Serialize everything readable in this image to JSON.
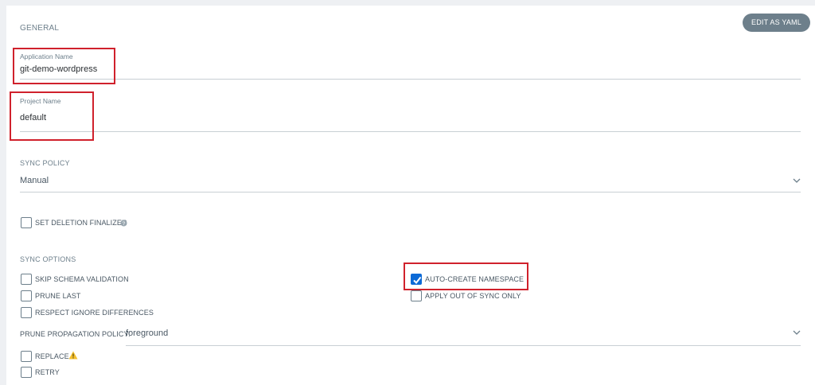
{
  "header": {
    "section_title": "GENERAL",
    "edit_yaml_label": "EDIT AS YAML"
  },
  "application": {
    "label": "Application Name",
    "value": "git-demo-wordpress"
  },
  "project": {
    "label": "Project Name",
    "value": "default"
  },
  "sync_policy": {
    "label": "SYNC POLICY",
    "value": "Manual"
  },
  "deletion_finalizer": {
    "label": "SET DELETION FINALIZER",
    "checked": false
  },
  "sync_options": {
    "title": "SYNC OPTIONS",
    "left": [
      {
        "label": "SKIP SCHEMA VALIDATION",
        "checked": false
      },
      {
        "label": "PRUNE LAST",
        "checked": false
      },
      {
        "label": "RESPECT IGNORE DIFFERENCES",
        "checked": false
      }
    ],
    "right": [
      {
        "label": "AUTO-CREATE NAMESPACE",
        "checked": true
      },
      {
        "label": "APPLY OUT OF SYNC ONLY",
        "checked": false
      }
    ]
  },
  "prune_policy": {
    "label": "PRUNE PROPAGATION POLICY:",
    "value": "foreground"
  },
  "bottom_options": [
    {
      "label": "REPLACE",
      "checked": false
    },
    {
      "label": "RETRY",
      "checked": false
    }
  ],
  "colors": {
    "highlight": "#d0212c",
    "checkbox_checked": "#0d6ad6",
    "button_bg": "#6d7f8b",
    "warning": "#f4c030"
  }
}
